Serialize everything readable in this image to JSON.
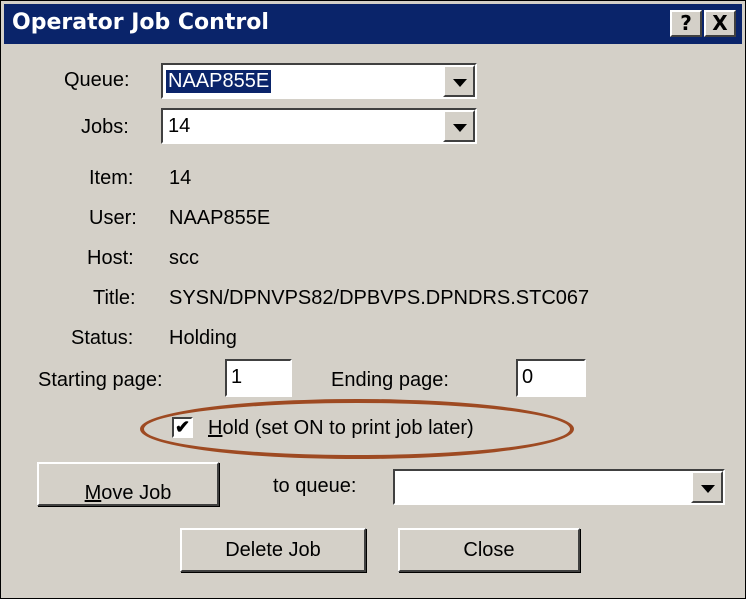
{
  "window": {
    "title": "Operator Job Control",
    "help_label": "?",
    "close_label": "X"
  },
  "form": {
    "queue_label": "Queue:",
    "queue_value": "NAAP855E",
    "jobs_label": "Jobs:",
    "jobs_value": "14",
    "item_label": "Item:",
    "item_value": "14",
    "user_label": "User:",
    "user_value": "NAAP855E",
    "host_label": "Host:",
    "host_value": "scc",
    "title_label": "Title:",
    "title_value": "SYSN/DPNVPS82/DPBVPS.DPNDRS.STC067",
    "status_label": "Status:",
    "status_value": "Holding",
    "starting_page_label": "Starting page:",
    "starting_page_value": "1",
    "ending_page_label": "Ending page:",
    "ending_page_value": "0",
    "hold_checkbox_label_accel": "H",
    "hold_checkbox_label_rest": "old (set ON to print job later)",
    "hold_checked": "✔",
    "to_queue_label": "to queue:",
    "to_queue_value": ""
  },
  "buttons": {
    "move_job_accel": "M",
    "move_job_rest": "ove Job",
    "delete_job": "Delete Job",
    "close": "Close"
  },
  "colors": {
    "titlebar": "#0a246a",
    "dialog_bg": "#d4d0c8",
    "highlight_oval": "#9e4a22"
  }
}
